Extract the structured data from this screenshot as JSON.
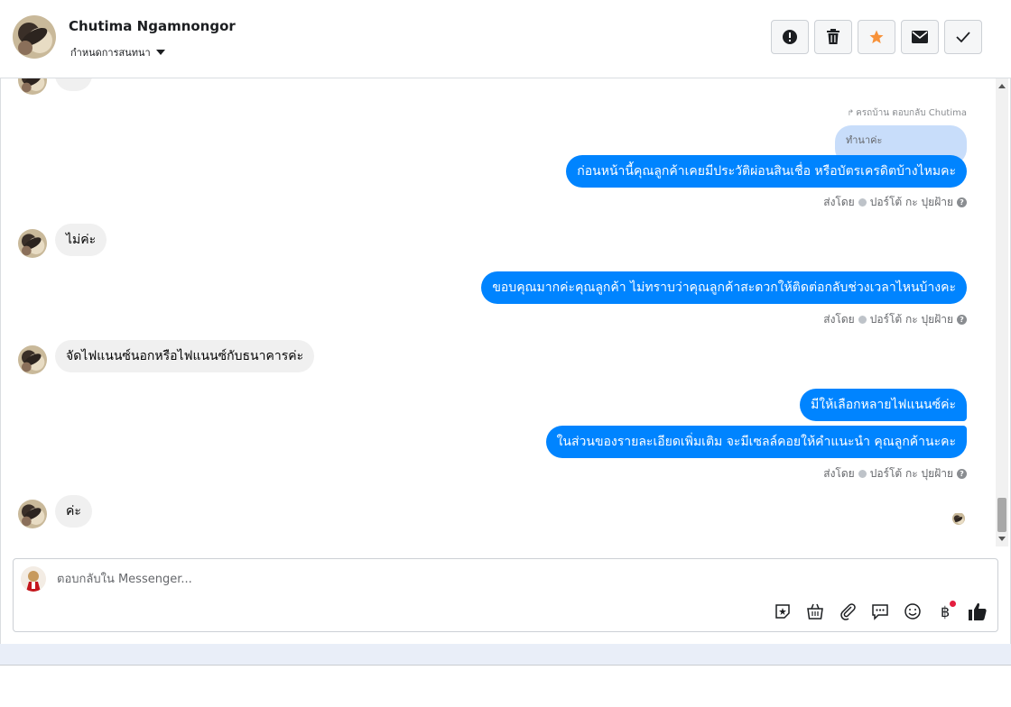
{
  "header": {
    "name": "Chutima Ngamnongor",
    "status_label": "กำหนดการสนทนา",
    "actions": [
      {
        "id": "report",
        "icon": "alert-icon"
      },
      {
        "id": "delete",
        "icon": "trash-icon"
      },
      {
        "id": "star",
        "icon": "star-icon"
      },
      {
        "id": "mail",
        "icon": "mail-icon"
      },
      {
        "id": "done",
        "icon": "check-icon"
      }
    ]
  },
  "conversation": {
    "partial_top_text": "ทำ",
    "reply_meta": "ครถบ้าน ตอบกลับ Chutima",
    "quoted_text": "ทำนาค่ะ",
    "messages": [
      {
        "side": "out",
        "text": "ก่อนหน้านี้คุณลูกค้าเคยมีประวัติผ่อนสินเชื่อ หรือบัตรเครดิตบ้างไหมคะ"
      },
      {
        "side": "in",
        "text": "ไม่ค่ะ"
      },
      {
        "side": "out",
        "text": "ขอบคุณมากค่ะคุณลูกค้า ไม่ทราบว่าคุณลูกค้าสะดวกให้ติดต่อกลับช่วงเวลาไหนบ้างคะ"
      },
      {
        "side": "in",
        "text": "จัดไฟแนนซ์นอกหรือไฟแนนซ์กับธนาคารค่ะ"
      },
      {
        "side": "out",
        "text": "มีให้เลือกหลายไฟแนนซ์ค่ะ"
      },
      {
        "side": "out",
        "text": "ในส่วนของรายละเอียดเพิ่มเติม จะมีเซลล์คอยให้คำแนะนำ คุณลูกค้านะคะ"
      },
      {
        "side": "in",
        "text": "ค่ะ"
      }
    ],
    "sent_by_label": "ส่งโดย",
    "sender_name": "ปอร์โต้ กะ ปุยฝ้าย"
  },
  "composer": {
    "placeholder": "ตอบกลับใน Messenger...",
    "tools": [
      "sticker-icon",
      "shop-icon",
      "attach-icon",
      "quick-reply-icon",
      "emoji-icon",
      "baht-icon",
      "like-icon"
    ]
  },
  "colors": {
    "outgoing_bubble": "#0084ff",
    "incoming_bubble": "#f0f0f0",
    "quote_bubble": "#c8ddfa",
    "star": "#f7923a",
    "notification_dot": "#e41e3f"
  }
}
